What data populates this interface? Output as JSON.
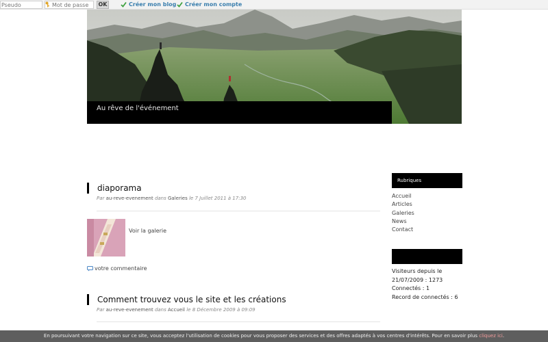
{
  "topbar": {
    "pseudo_placeholder": "Pseudo",
    "password_placeholder": "Mot de passe",
    "ok_label": "OK",
    "create_blog_label": "Créer mon blog",
    "create_account_label": "Créer mon compte",
    "link_color": "#3b7fae",
    "check_color": "#3fa140"
  },
  "banner": {
    "title": "Au rêve de l'événement"
  },
  "posts": [
    {
      "title": "diaporama",
      "meta_prefix": "Par",
      "author": "au-reve-evenement",
      "meta_in": "dans",
      "category": "Galeries",
      "date": "le 7 Juillet 2011 à 17:30",
      "gallery_link": "Voir la galerie",
      "comment_link": "votre commentaire"
    },
    {
      "title": "Comment trouvez vous le site et les créations",
      "meta_prefix": "Par",
      "author": "au-reve-evenement",
      "meta_in": "dans",
      "category": "Accueil",
      "date": "le 8 Décembre 2009 à 09:09"
    }
  ],
  "sidebar": {
    "rubriques_title": "Rubriques",
    "nav": [
      "Accueil",
      "Articles",
      "Galeries",
      "News",
      "Contact"
    ],
    "stats_title": "",
    "stats": [
      "Visiteurs depuis le",
      "21/07/2009 : 1273",
      "Connectés : 1",
      "Record de connectés : 6"
    ]
  },
  "cookie": {
    "text": "En poursuivant votre navigation sur ce site, vous acceptez l'utilisation de cookies pour vous proposer des services et des offres adaptés à vos centres d'intérêts. Pour en savoir plus",
    "link": "cliquez ici",
    "suffix": ".",
    "link_color": "#f39c9c"
  }
}
